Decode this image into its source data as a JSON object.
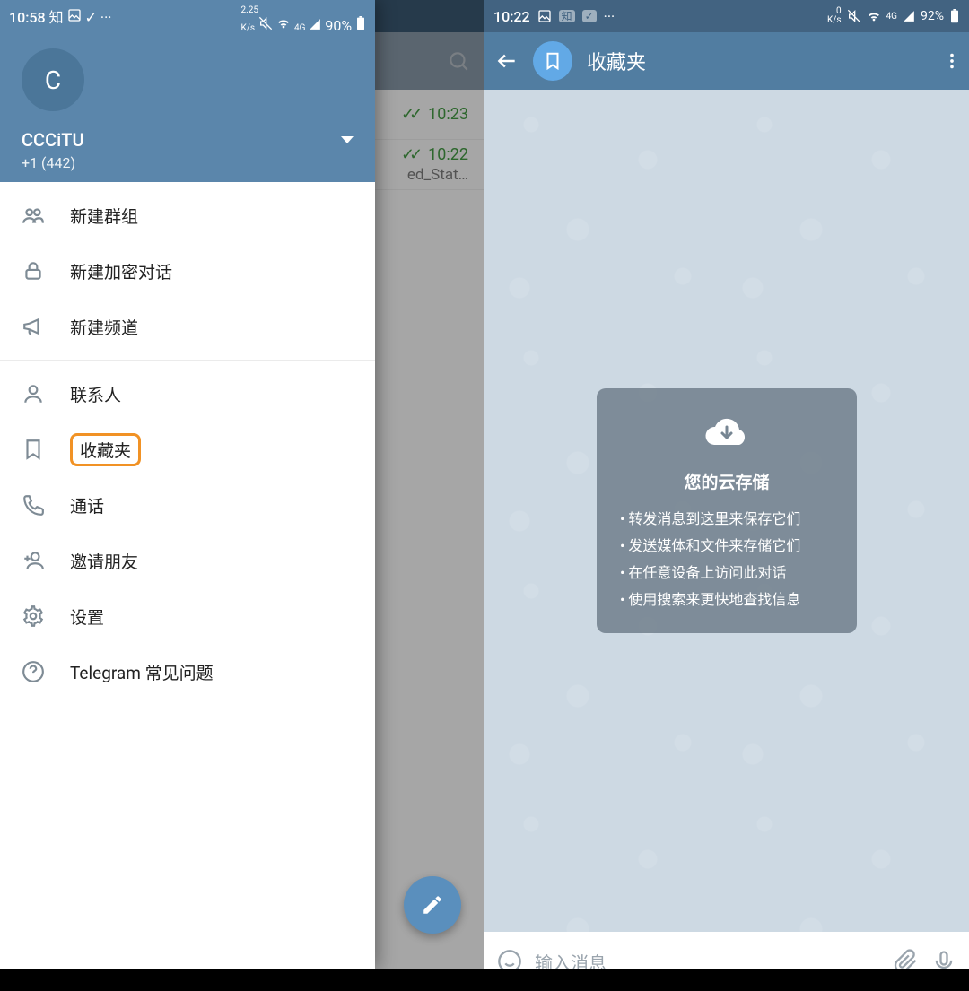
{
  "left": {
    "statusbar": {
      "time": "10:58",
      "net": "2.25\nK/s",
      "signal": "4G",
      "battery": "90%"
    },
    "profile": {
      "avatar_initial": "C",
      "name": "CCCiTU",
      "phone": "+1 (442)"
    },
    "menu": [
      {
        "id": "new-group",
        "label": "新建群组",
        "icon": "group"
      },
      {
        "id": "new-secret-chat",
        "label": "新建加密对话",
        "icon": "lock"
      },
      {
        "id": "new-channel",
        "label": "新建频道",
        "icon": "megaphone"
      },
      {
        "sep": true
      },
      {
        "id": "contacts",
        "label": "联系人",
        "icon": "person"
      },
      {
        "id": "saved",
        "label": "收藏夹",
        "icon": "bookmark",
        "highlighted": true
      },
      {
        "id": "calls",
        "label": "通话",
        "icon": "phone"
      },
      {
        "id": "invite",
        "label": "邀请朋友",
        "icon": "person-add"
      },
      {
        "id": "settings",
        "label": "设置",
        "icon": "gear"
      },
      {
        "id": "faq",
        "label": "Telegram 常见问题",
        "icon": "help"
      }
    ],
    "chat_rows": [
      {
        "time": "10:23"
      },
      {
        "time": "10:22",
        "preview": "ed_Stat…"
      }
    ]
  },
  "right": {
    "statusbar": {
      "time": "10:22",
      "net": "0\nK/s",
      "signal": "4G",
      "battery": "92%"
    },
    "appbar": {
      "title": "收藏夹"
    },
    "info": {
      "title": "您的云存储",
      "items": [
        "转发消息到这里来保存它们",
        "发送媒体和文件来存储它们",
        "在任意设备上访问此对话",
        "使用搜索来更快地查找信息"
      ]
    },
    "input": {
      "placeholder": "输入消息"
    }
  },
  "colors": {
    "accent": "#517da1",
    "highlight": "#f19225"
  }
}
